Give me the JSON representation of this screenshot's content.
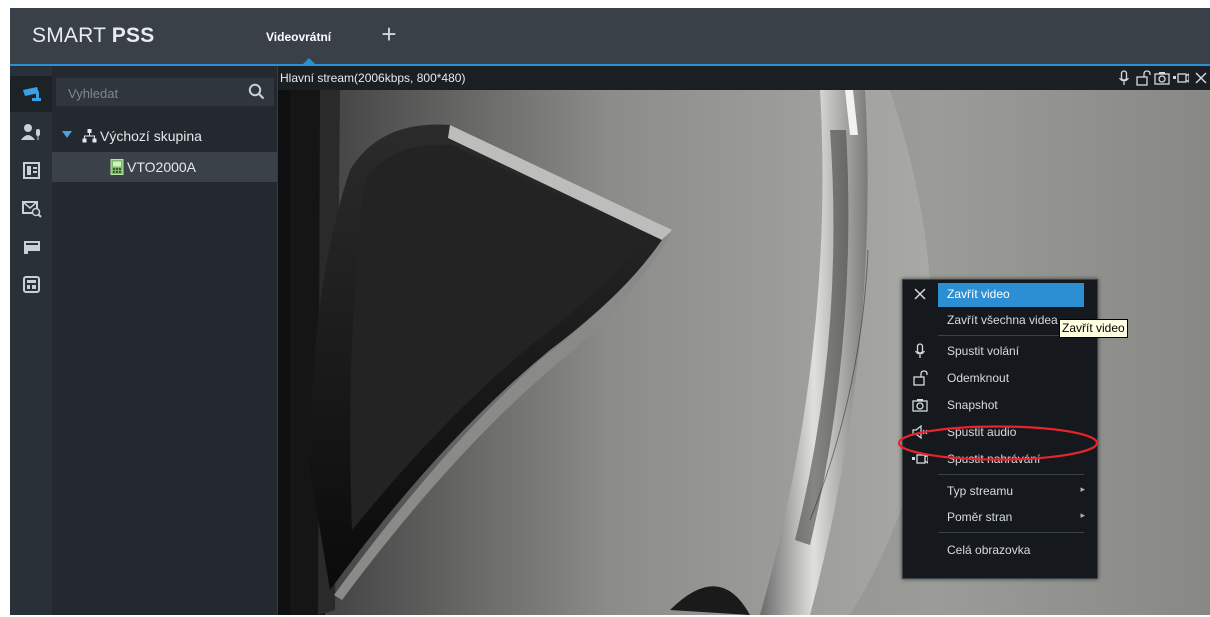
{
  "app": {
    "brand_light": "SMART ",
    "brand_bold": "PSS",
    "accent_color": "#2c8fd3"
  },
  "tabs": [
    {
      "label": "Videovrátní",
      "active": true
    }
  ],
  "add_tab_label": "+",
  "rail": [
    {
      "icon": "camera-icon",
      "active": true
    },
    {
      "icon": "user-mic-icon",
      "active": false
    },
    {
      "icon": "door-icon",
      "active": false
    },
    {
      "icon": "message-search-icon",
      "active": false
    },
    {
      "icon": "card-reader-icon",
      "active": false
    },
    {
      "icon": "panel-icon",
      "active": false
    }
  ],
  "tree": {
    "search_placeholder": "Vyhledat",
    "group_label": "Výchozí skupina",
    "device_label": "VTO2000A"
  },
  "video": {
    "stream_info": "Hlavní stream(2006kbps, 800*480)",
    "tools": [
      "microphone-icon",
      "unlock-icon",
      "snapshot-icon",
      "record-icon",
      "close-icon"
    ]
  },
  "context_menu": {
    "items": [
      {
        "label": "Zavřít video",
        "icon": "close-icon",
        "highlighted": true
      },
      {
        "label": "Zavřít všechna videa",
        "icon": ""
      },
      {
        "label": "Spustit volání",
        "icon": "microphone-icon"
      },
      {
        "label": "Odemknout",
        "icon": "unlock-icon"
      },
      {
        "label": "Snapshot",
        "icon": "snapshot-icon"
      },
      {
        "label": "Spustit audio",
        "icon": "speaker-mute-icon",
        "circled": true
      },
      {
        "label": "Spustit nahrávání",
        "icon": "record-icon"
      },
      {
        "label": "Typ streamu",
        "submenu": true
      },
      {
        "label": "Poměr stran",
        "submenu": true
      },
      {
        "label": "Celá obrazovka"
      }
    ],
    "submenu_arrow": "▸",
    "annotation_color": "#e8242b"
  },
  "tooltip": "Zavřít video"
}
